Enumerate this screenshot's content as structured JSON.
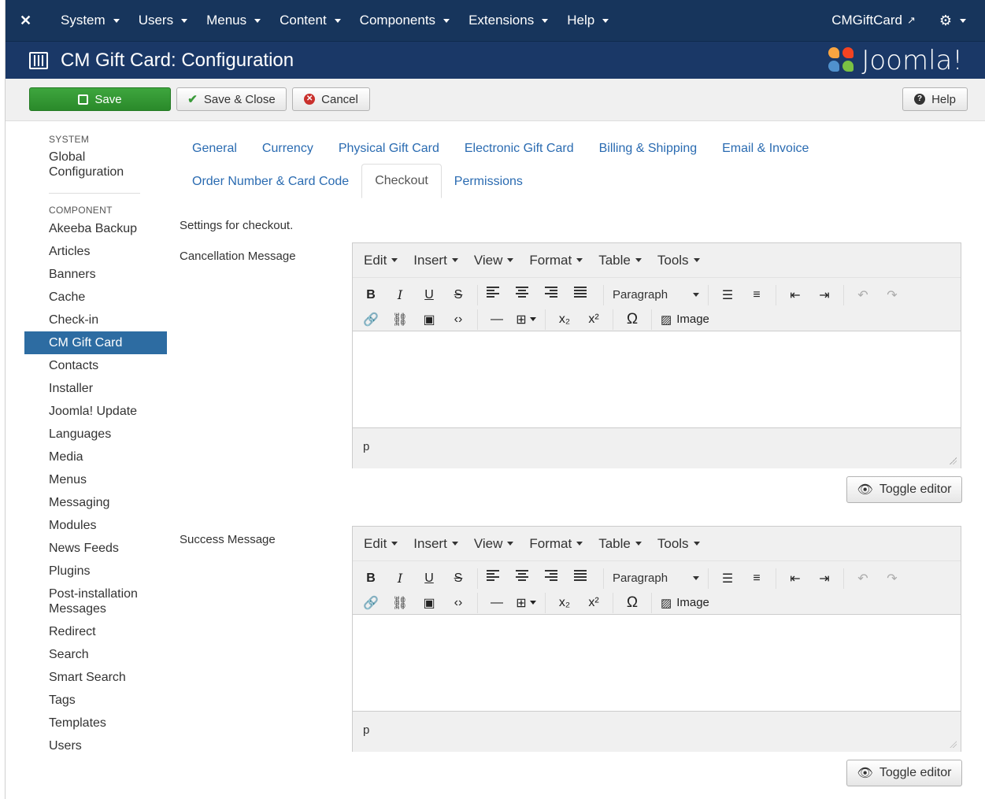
{
  "topnav": {
    "menus": [
      "System",
      "Users",
      "Menus",
      "Content",
      "Components",
      "Extensions",
      "Help"
    ],
    "site_link": "CMGiftCard"
  },
  "header": {
    "title": "CM Gift Card: Configuration",
    "brand": "Joomla!"
  },
  "toolbar": {
    "save_label": "Save",
    "save_close_label": "Save & Close",
    "cancel_label": "Cancel",
    "help_label": "Help"
  },
  "sidebar": {
    "system_heading": "SYSTEM",
    "system_items": [
      "Global Configuration"
    ],
    "component_heading": "COMPONENT",
    "component_items": [
      "Akeeba Backup",
      "Articles",
      "Banners",
      "Cache",
      "Check-in",
      "CM Gift Card",
      "Contacts",
      "Installer",
      "Joomla! Update",
      "Languages",
      "Media",
      "Menus",
      "Messaging",
      "Modules",
      "News Feeds",
      "Plugins",
      "Post-installation Messages",
      "Redirect",
      "Search",
      "Smart Search",
      "Tags",
      "Templates",
      "Users"
    ],
    "active_item": "CM Gift Card"
  },
  "tabs": {
    "row1": [
      "General",
      "Currency",
      "Physical Gift Card",
      "Electronic Gift Card",
      "Billing & Shipping",
      "Email & Invoice"
    ],
    "row2": [
      "Order Number & Card Code",
      "Checkout",
      "Permissions"
    ],
    "active": "Checkout"
  },
  "content": {
    "description": "Settings for checkout.",
    "fields": [
      {
        "label": "Cancellation Message",
        "status_path": "p",
        "toggle_label": "Toggle editor"
      },
      {
        "label": "Success Message",
        "status_path": "p",
        "toggle_label": "Toggle editor"
      }
    ]
  },
  "editor": {
    "menus": [
      "Edit",
      "Insert",
      "View",
      "Format",
      "Table",
      "Tools"
    ],
    "format_select": "Paragraph",
    "image_label": "Image"
  },
  "colors": {
    "navbar": "#17355c",
    "header": "#1a3867",
    "save_button": "#2f922f",
    "active_sidebar": "#2d6ca2",
    "link": "#2a6bb1"
  }
}
